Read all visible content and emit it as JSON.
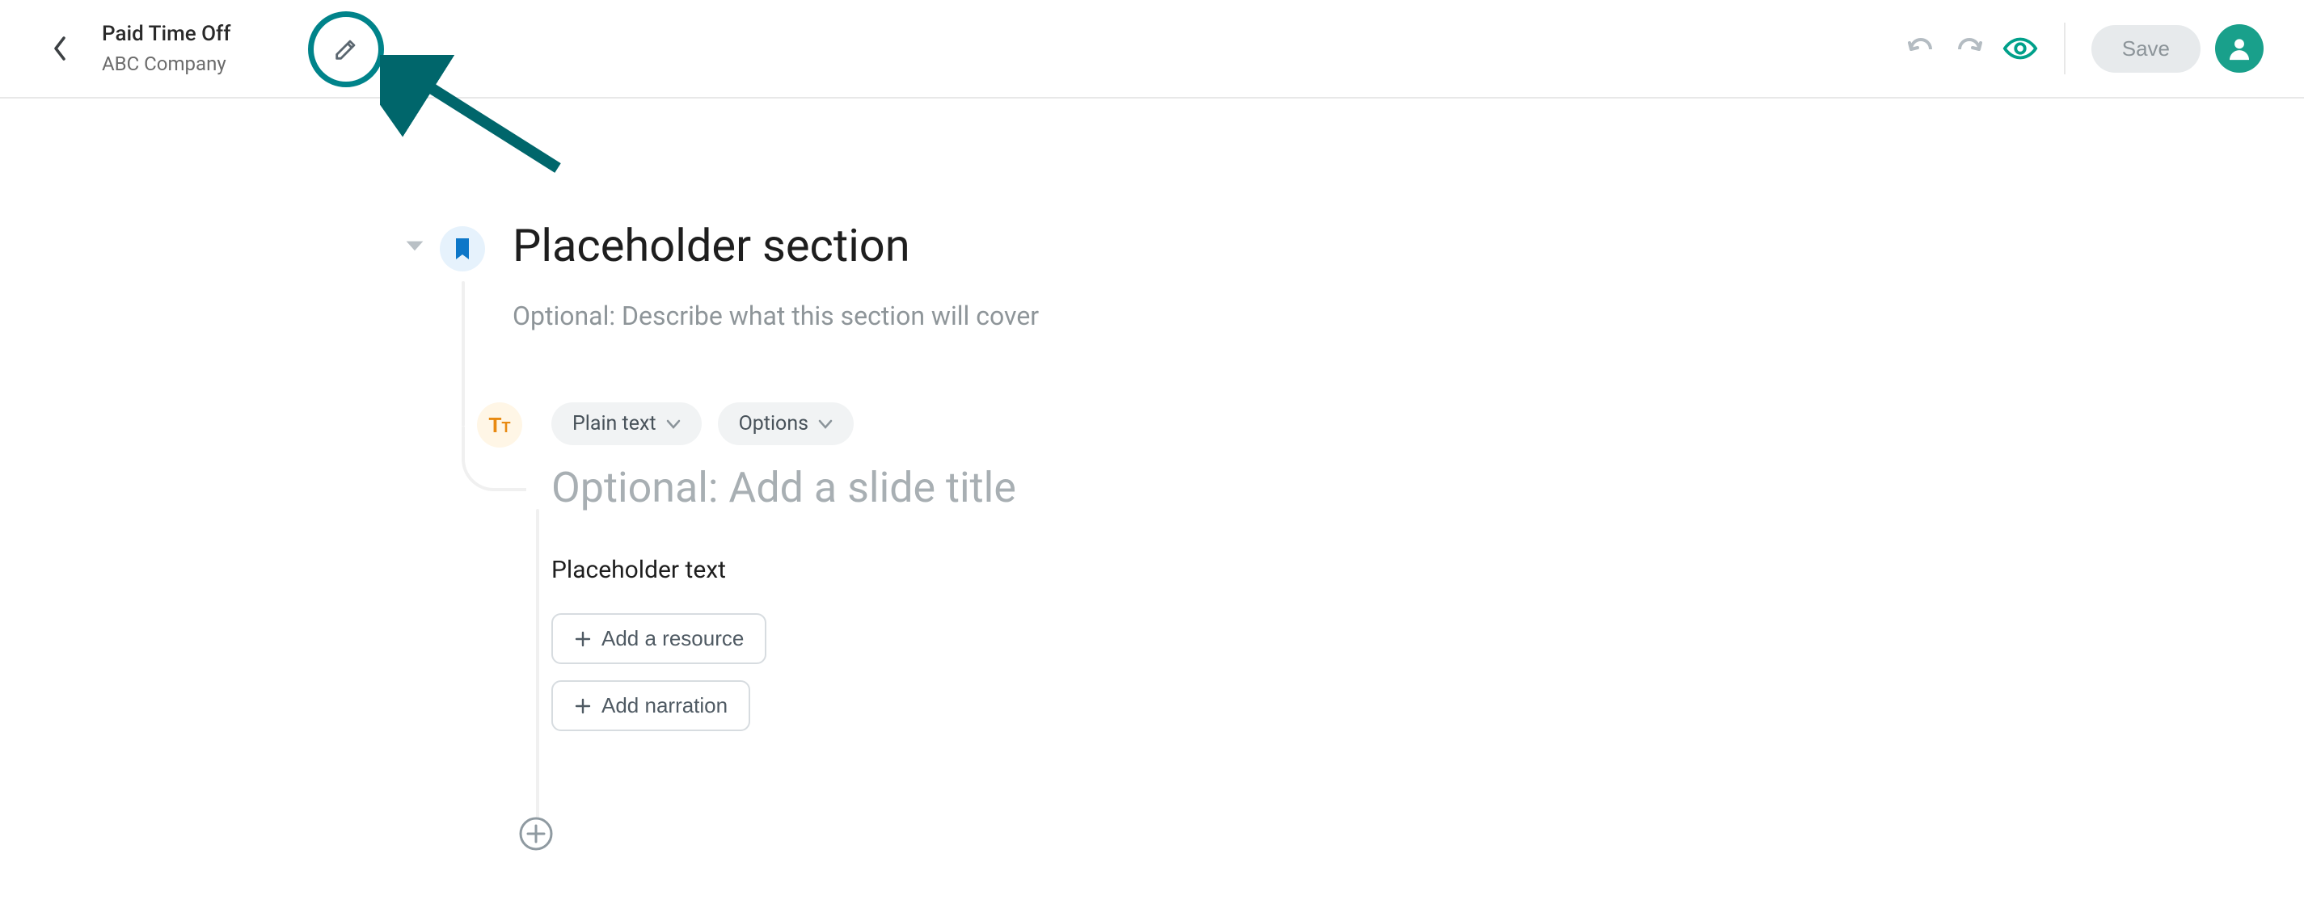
{
  "header": {
    "project_title": "Paid Time Off",
    "company_name": "ABC Company",
    "save_label": "Save"
  },
  "section": {
    "title": "Placeholder section",
    "description_placeholder": "Optional: Describe what this section will cover"
  },
  "slide": {
    "type_pill": "Plain text",
    "options_pill": "Options",
    "title_placeholder": "Optional: Add a slide title",
    "body_text": "Placeholder text",
    "add_resource_label": "Add a resource",
    "add_narration_label": "Add narration"
  },
  "icons": {
    "bookmark": "bookmark-icon",
    "text_type": "text-type-icon"
  },
  "colors": {
    "accent": "#00838a",
    "teal_eye": "#00a08a",
    "section_badge_bg": "#e6f2fc",
    "section_badge_icon": "#0d77c8",
    "text_badge_bg": "#fff6e6",
    "text_badge_icon": "#e88a12"
  }
}
